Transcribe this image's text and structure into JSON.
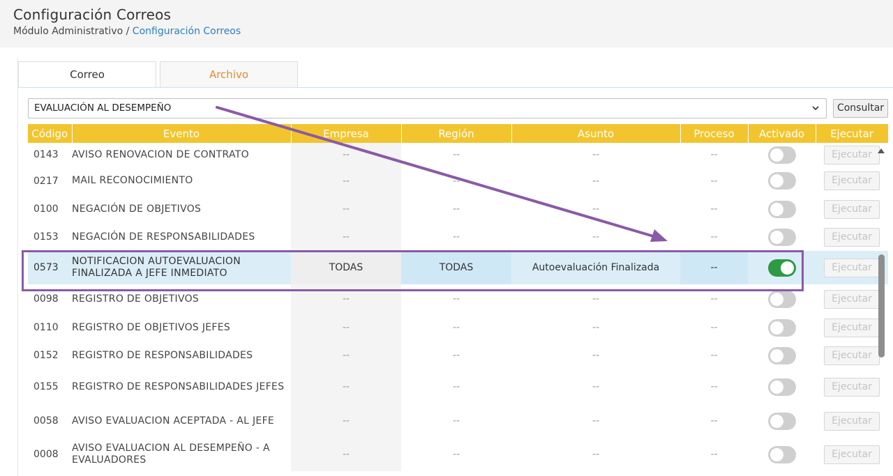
{
  "header": {
    "title": "Configuración Correos",
    "breadcrumb_root": "Módulo Administrativo",
    "breadcrumb_sep": " / ",
    "breadcrumb_current": "Configuración Correos"
  },
  "tabs": [
    {
      "label": "Correo"
    },
    {
      "label": "Archivo"
    }
  ],
  "filter": {
    "selected": "EVALUACIÓN AL DESEMPEÑO",
    "button_label": "Consultar"
  },
  "table": {
    "columns": [
      "Código",
      "Evento",
      "Empresa",
      "Región",
      "Asunto",
      "Proceso",
      "Activado",
      "Ejecutar"
    ],
    "rows": [
      {
        "code": "0143",
        "event": "AVISO RENOVACION DE CONTRATO",
        "empresa": "--",
        "region": "--",
        "asunto": "--",
        "proceso": "--",
        "activated": false,
        "exec": "Ejecutar"
      },
      {
        "code": "0217",
        "event": "MAIL RECONOCIMIENTO",
        "empresa": "--",
        "region": "--",
        "asunto": "--",
        "proceso": "--",
        "activated": false,
        "exec": "Ejecutar"
      },
      {
        "code": "0100",
        "event": "NEGACIÓN DE OBJETIVOS",
        "empresa": "--",
        "region": "--",
        "asunto": "--",
        "proceso": "--",
        "activated": false,
        "exec": "Ejecutar"
      },
      {
        "code": "0153",
        "event": "NEGACIÓN DE RESPONSABILIDADES",
        "empresa": "--",
        "region": "--",
        "asunto": "--",
        "proceso": "--",
        "activated": false,
        "exec": "Ejecutar"
      },
      {
        "code": "0573",
        "event": "NOTIFICACION AUTOEVALUACION FINALIZADA A JEFE INMEDIATO",
        "empresa": "TODAS",
        "region": "TODAS",
        "asunto": "Autoevaluación Finalizada",
        "proceso": "--",
        "activated": true,
        "exec": "Ejecutar"
      },
      {
        "code": "0098",
        "event": "REGISTRO DE OBJETIVOS",
        "empresa": "--",
        "region": "--",
        "asunto": "--",
        "proceso": "--",
        "activated": false,
        "exec": "Ejecutar"
      },
      {
        "code": "0110",
        "event": "REGISTRO DE OBJETIVOS JEFES",
        "empresa": "--",
        "region": "--",
        "asunto": "--",
        "proceso": "--",
        "activated": false,
        "exec": "Ejecutar"
      },
      {
        "code": "0152",
        "event": "REGISTRO DE RESPONSABILIDADES",
        "empresa": "--",
        "region": "--",
        "asunto": "--",
        "proceso": "--",
        "activated": false,
        "exec": "Ejecutar"
      },
      {
        "code": "0155",
        "event": "REGISTRO DE RESPONSABILIDADES JEFES",
        "empresa": "--",
        "region": "--",
        "asunto": "--",
        "proceso": "--",
        "activated": false,
        "exec": "Ejecutar"
      },
      {
        "code": "0058",
        "event": "AVISO EVALUACION ACEPTADA - AL JEFE",
        "empresa": "--",
        "region": "--",
        "asunto": "--",
        "proceso": "--",
        "activated": false,
        "exec": "Ejecutar"
      },
      {
        "code": "0008",
        "event": "AVISO EVALUACION AL DESEMPEÑO - A EVALUADORES",
        "empresa": "--",
        "region": "--",
        "asunto": "--",
        "proceso": "--",
        "activated": false,
        "exec": "Ejecutar"
      }
    ]
  },
  "colors": {
    "header_yellow": "#f2c52f",
    "toggle_on": "#2e9a44",
    "annotation_purple": "#8a5aa6",
    "tab_active_text": "#e6892e",
    "breadcrumb_link": "#2f7fc1"
  }
}
